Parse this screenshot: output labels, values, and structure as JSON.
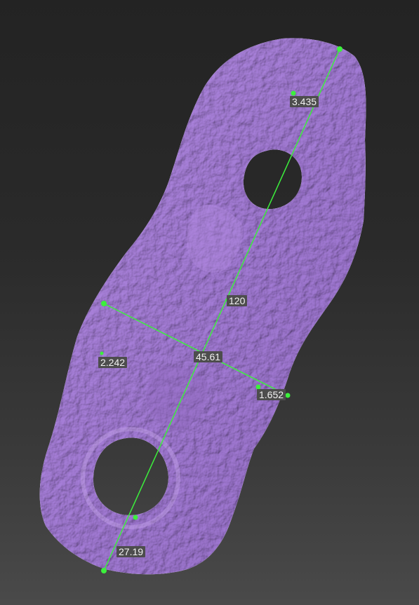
{
  "viewport": {
    "background": "#2a2a2a",
    "mesh_color": "#a67cd8",
    "mesh_shadow": "#7d5aa8",
    "measure_color": "#3cf03c",
    "label_background": "#4d4d4d",
    "label_text_color": "#f2f2f2"
  },
  "measurements": [
    {
      "value": "3.435",
      "kind": "hole-diameter-top"
    },
    {
      "value": "120",
      "kind": "length"
    },
    {
      "value": "45.61",
      "kind": "width"
    },
    {
      "value": "2.242",
      "kind": "thickness-left"
    },
    {
      "value": "1.652",
      "kind": "thickness-right"
    },
    {
      "value": "27.19",
      "kind": "hole-diameter-bottom"
    }
  ]
}
